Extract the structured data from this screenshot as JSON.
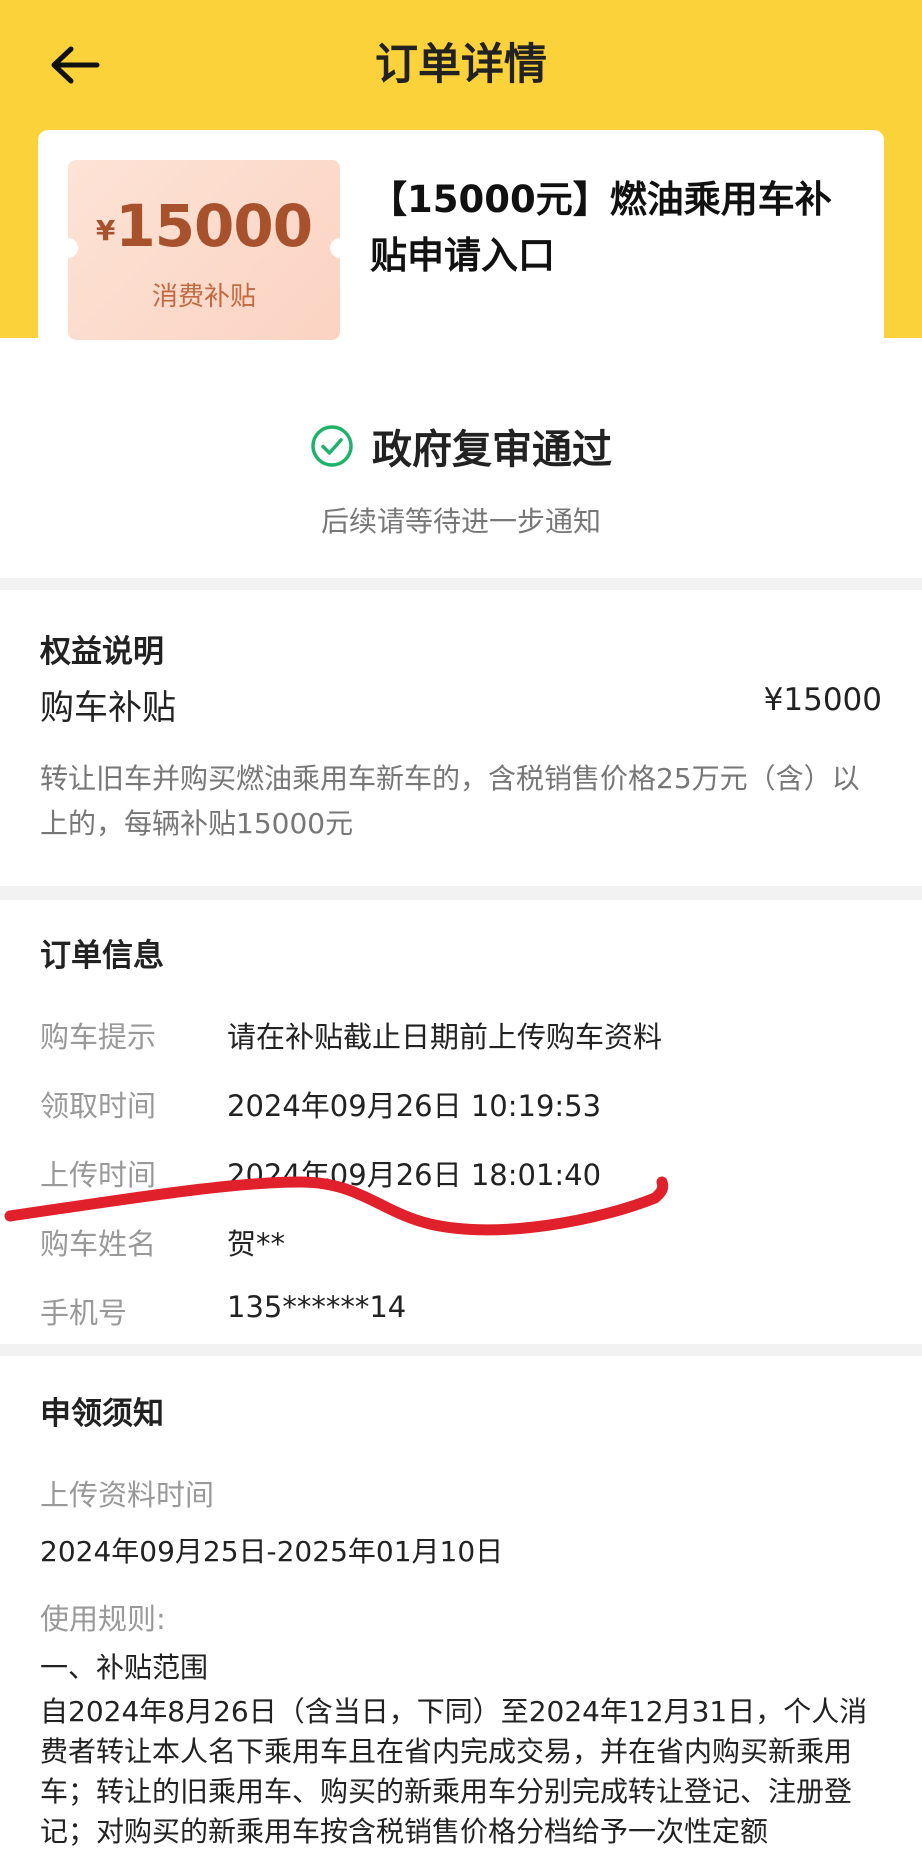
{
  "header": {
    "title": "订单详情",
    "back_icon": "arrow-left-icon"
  },
  "coupon": {
    "currency": "¥",
    "amount": "15000",
    "label": "消费补贴",
    "title": "【15000元】燃油乘用车补贴申请入口"
  },
  "status": {
    "icon": "check-circle-icon",
    "text": "政府复审通过",
    "subtext": "后续请等待进一步通知",
    "color": "#1db36b"
  },
  "benefit": {
    "section_title": "权益说明",
    "name": "购车补贴",
    "price": "¥15000",
    "description": "转让旧车并购买燃油乘用车新车的，含税销售价格25万元（含）以上的，每辆补贴15000元"
  },
  "order_info": {
    "section_title": "订单信息",
    "rows": [
      {
        "label": "购车提示",
        "value": "请在补贴截止日期前上传购车资料"
      },
      {
        "label": "领取时间",
        "value": "2024年09月26日 10:19:53"
      },
      {
        "label": "上传时间",
        "value": "2024年09月26日 18:01:40"
      },
      {
        "label": "购车姓名",
        "value": "贺**"
      },
      {
        "label": "手机号",
        "value": "135******14"
      }
    ]
  },
  "notice": {
    "section_title": "申领须知",
    "upload_time_label": "上传资料时间",
    "upload_time_value": "2024年09月25日-2025年01月10日",
    "rules_label": "使用规则:",
    "rules_heading": "一、补贴范围",
    "rules_text": "自2024年8月26日（含当日，下同）至2024年12月31日，个人消费者转让本人名下乘用车且在省内完成交易，并在省内购买新乘用车；转让的旧乘用车、购买的新乘用车分别完成转让登记、注册登记；对购买的新乘用车按含税销售价格分档给予一次性定额"
  },
  "colors": {
    "header_bg": "#fcd23a",
    "annotation_stroke": "#e0202a",
    "coupon_text": "#a8522d"
  }
}
